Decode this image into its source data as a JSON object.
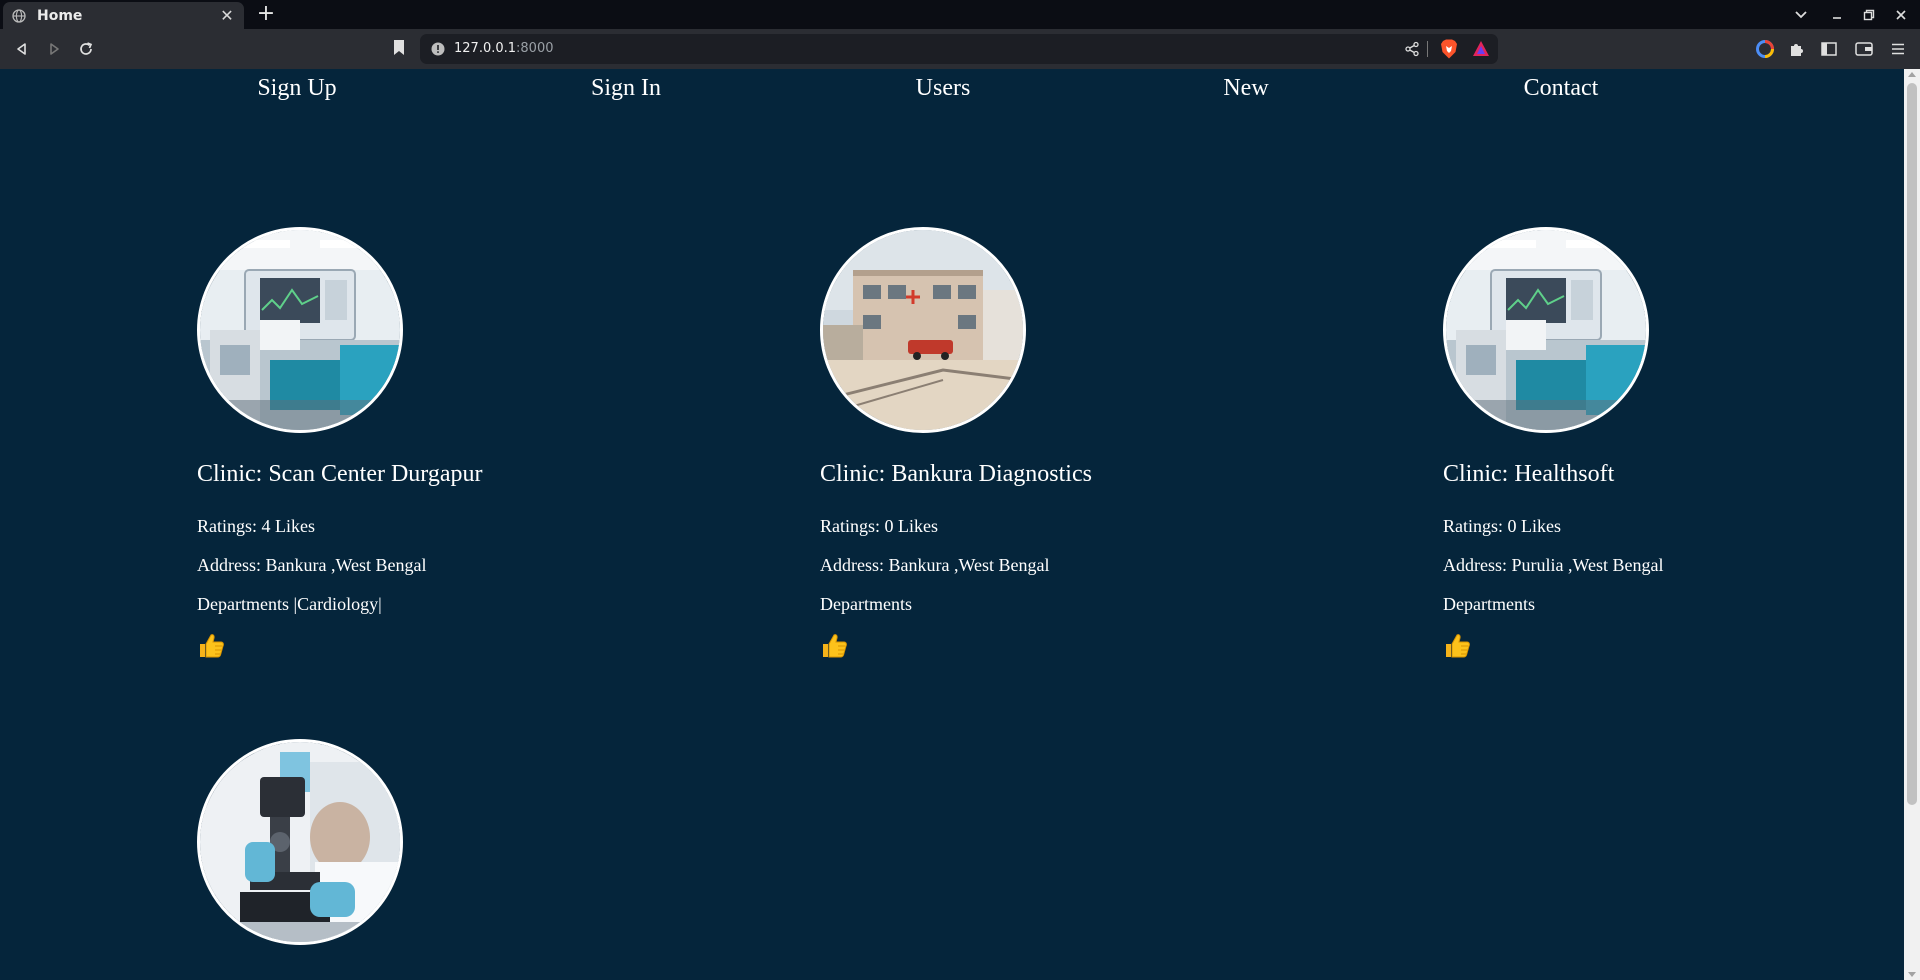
{
  "browser": {
    "tab_title": "Home",
    "url_host": "127.0.0.1",
    "url_port": ":8000"
  },
  "nav": {
    "items": [
      "Sign Up",
      "Sign In",
      "Users",
      "New",
      "Contact"
    ]
  },
  "clinics": [
    {
      "name": "Clinic: Scan Center Durgapur",
      "ratings": "Ratings: 4 Likes",
      "address": "Address: Bankura ,West Bengal",
      "departments": "Departments |Cardiology|",
      "image": "hospital-monitor-room"
    },
    {
      "name": "Clinic: Bankura Diagnostics",
      "ratings": "Ratings: 0 Likes",
      "address": "Address: Bankura ,West Bengal",
      "departments": "Departments",
      "image": "clinic-building-exterior"
    },
    {
      "name": "Clinic: Healthsoft",
      "ratings": "Ratings: 0 Likes",
      "address": "Address: Purulia ,West Bengal",
      "departments": "Departments",
      "image": "hospital-monitor-room"
    },
    {
      "image": "lab-microscope"
    }
  ],
  "colors": {
    "page_bg": "#05253b",
    "text": "#ffffff",
    "chrome_bg": "#2b2d33",
    "tabstrip_bg": "#0b0d14"
  }
}
